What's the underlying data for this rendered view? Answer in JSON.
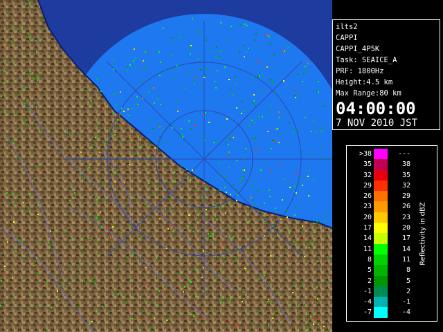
{
  "info": {
    "station": "ilts2",
    "product": "CAPPI",
    "product_code": "CAPPI_4P5K",
    "task": "Task: SEAICE_A",
    "prf": "PRF: 1800Hz",
    "height": "Height:4.5 km",
    "max_range": "Max Range:80 km",
    "time": "04:00:00",
    "date": "7 NOV 2010 JST"
  },
  "legend": {
    "title": "Reflectivity in dBZ",
    "rows": [
      {
        "lo": ">38",
        "hi": "---",
        "color": "#ff00ff"
      },
      {
        "lo": "35",
        "hi": "38",
        "color": "#c00050"
      },
      {
        "lo": "32",
        "hi": "35",
        "color": "#e80010"
      },
      {
        "lo": "29",
        "hi": "32",
        "color": "#ff3000"
      },
      {
        "lo": "26",
        "hi": "29",
        "color": "#ff7000"
      },
      {
        "lo": "23",
        "hi": "26",
        "color": "#ff9a00"
      },
      {
        "lo": "20",
        "hi": "23",
        "color": "#ffc800"
      },
      {
        "lo": "17",
        "hi": "20",
        "color": "#ffff00"
      },
      {
        "lo": "14",
        "hi": "17",
        "color": "#c8ff00"
      },
      {
        "lo": "11",
        "hi": "14",
        "color": "#00ff00"
      },
      {
        "lo": "8",
        "hi": "11",
        "color": "#00d200"
      },
      {
        "lo": "5",
        "hi": "8",
        "color": "#00b400"
      },
      {
        "lo": "2",
        "hi": "5",
        "color": "#009600"
      },
      {
        "lo": "-1",
        "hi": "2",
        "color": "#008c50"
      },
      {
        "lo": "-4",
        "hi": "-1",
        "color": "#00b4b4"
      },
      {
        "lo": "-7",
        "hi": "-4",
        "color": "#00ffff"
      }
    ]
  },
  "map_colors": {
    "sea": "#1e78f0",
    "land": "#7a6140",
    "outside": "#1e3ca0"
  }
}
